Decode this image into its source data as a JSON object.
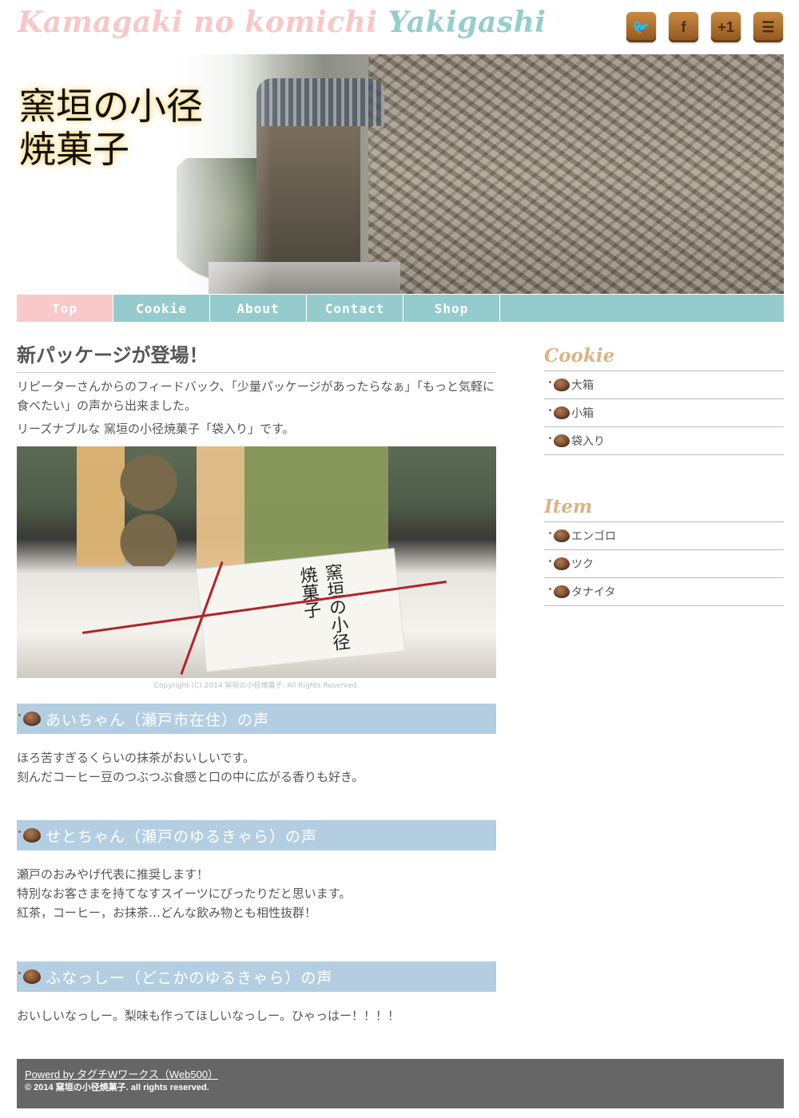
{
  "site": {
    "title_part1": "Kamagaki no komichi",
    "title_part2": "Yakigashi"
  },
  "social": [
    {
      "name": "twitter",
      "glyph": "🐦"
    },
    {
      "name": "facebook",
      "glyph": "f"
    },
    {
      "name": "google-plus",
      "glyph": "+1"
    },
    {
      "name": "rss",
      "glyph": "☰"
    }
  ],
  "hero": {
    "title_line1": "窯垣の小径",
    "title_line2": "焼菓子"
  },
  "nav": {
    "items": [
      {
        "label": "Top",
        "active": true
      },
      {
        "label": "Cookie",
        "active": false
      },
      {
        "label": "About",
        "active": false
      },
      {
        "label": "Contact",
        "active": false
      },
      {
        "label": "Shop",
        "active": false
      }
    ]
  },
  "main": {
    "heading": "新パッケージが登場！",
    "lead1": "リピーターさんからのフィードバック、「少量パッケージがあったらなぁ」「もっと気軽に食べたい」の声から出来ました。",
    "lead2": "リーズナブルな 窯垣の小径焼菓子「袋入り」です。",
    "photo_label": "窯垣の小径焼菓子",
    "photo_caption": "Copyright (C) 2014 窯垣の小径焼菓子. All Rights Reserved.",
    "voices": [
      {
        "title": "あいちゃん（瀬戸市在住）の声",
        "lines": [
          "ほろ苦すぎるくらいの抹茶がおいしいです。",
          "刻んだコーヒー豆のつぶつぶ食感と口の中に広がる香りも好き。"
        ]
      },
      {
        "title": "せとちゃん（瀬戸のゆるきゃら）の声",
        "lines": [
          "瀬戸のおみやげ代表に推奨します！",
          "特別なお客さまを持てなすスイーツにぴったりだと思います。",
          "紅茶，コーヒー，お抹茶…どんな飲み物とも相性抜群！"
        ]
      },
      {
        "title": "ふなっしー（どこかのゆるきゃら）の声",
        "lines": [
          "おいしいなっしー。梨味も作ってほしいなっしー。ひゃっはー！！！！"
        ]
      }
    ]
  },
  "sidebar": {
    "cookie_heading": "Cookie",
    "cookie_items": [
      "大箱",
      "小箱",
      "袋入り"
    ],
    "item_heading": "Item",
    "item_items": [
      "エンゴロ",
      "ツク",
      "タナイタ"
    ]
  },
  "footer": {
    "powered": "Powerd by タグチWワークス（Web500）",
    "rights": "© 2014 窯垣の小径焼菓子. all rights reserved."
  },
  "colors": {
    "title_pink": "#f8c7c7",
    "title_teal": "#96cdcf",
    "nav_bg": "#96cbcd",
    "nav_active": "#f9c9c9",
    "voice_header": "#b3cee1",
    "sidebar_heading": "#d9b483",
    "footer_bg": "#666666"
  }
}
